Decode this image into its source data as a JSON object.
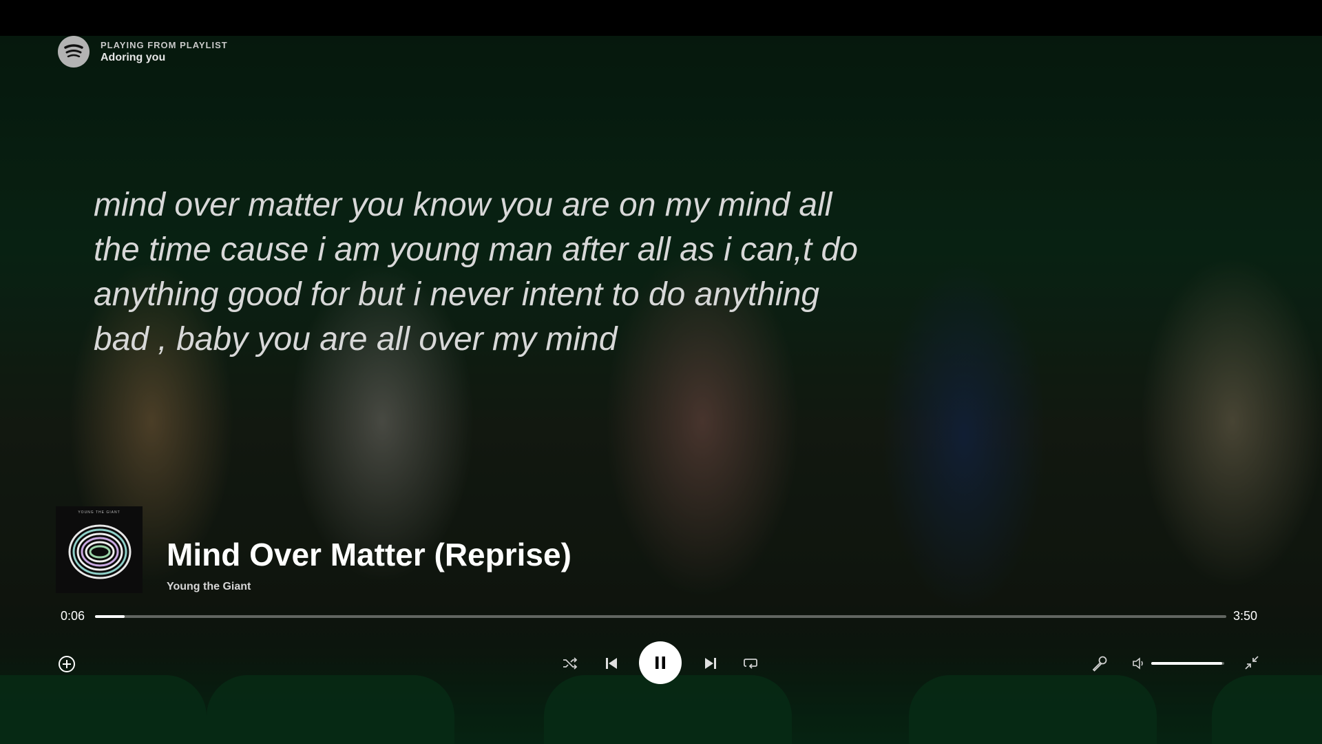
{
  "header": {
    "context_label": "PLAYING FROM PLAYLIST",
    "playlist_name": "Adoring you"
  },
  "lyrics": {
    "lines": [
      "mind over matter you know you are on my mind all",
      "the time cause i am young man after all as i can,t do",
      "anything good for but i never intent to do anything",
      "bad , baby you are all over my mind"
    ]
  },
  "track": {
    "title": "Mind Over Matter (Reprise)",
    "artist": "Young the Giant",
    "album_art_caption": "YOUNG THE GIANT"
  },
  "playback": {
    "current_time": "0:06",
    "total_time": "3:50",
    "progress_fraction": 0.026,
    "state": "playing"
  },
  "volume": {
    "level_fraction": 0.97
  },
  "icons": {
    "logo": "spotify-logo-icon",
    "add": "add-circle-icon",
    "shuffle": "shuffle-icon",
    "previous": "skip-previous-icon",
    "play_pause": "pause-icon",
    "next": "skip-next-icon",
    "repeat": "repeat-icon",
    "lyrics": "microphone-icon",
    "volume": "volume-icon",
    "exit_fullscreen": "minimize-icon"
  },
  "colors": {
    "text_primary": "#ffffff",
    "text_secondary": "#d6d6d6",
    "lyrics": "#d8d8d8",
    "accent_progress": "#ffffff"
  }
}
